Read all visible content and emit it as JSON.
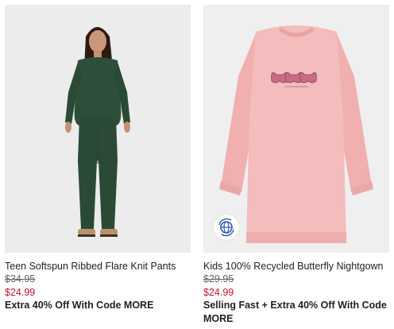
{
  "products": [
    {
      "name": "Teen Softspun Ribbed Flare Knit Pants",
      "original_price": "$34.95",
      "sale_price": "$24.99",
      "promo": "Extra 40% Off With Code MORE"
    },
    {
      "name": "Kids 100% Recycled Butterfly Nightgown",
      "original_price": "$29.95",
      "sale_price": "$24.99",
      "promo": "Selling Fast + Extra 40% Off With Code MORE",
      "badge_icon": "recycled-globe-icon"
    }
  ],
  "colors": {
    "sale_price": "#c8102e",
    "original_price": "#666666",
    "text": "#222222",
    "pants": "#2b4a35",
    "nightgown": "#f2b8b8",
    "badge": "#2f57b8"
  }
}
